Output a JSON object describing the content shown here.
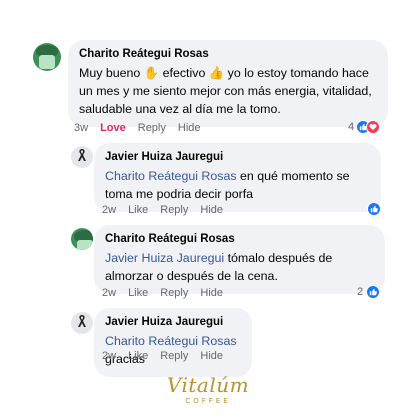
{
  "comments": [
    {
      "author": "Charito Reátegui Rosas",
      "text_parts": [
        "Muy bueno ",
        " efectivo ",
        " yo lo estoy tomando hace un mes y me siento mejor con más energia, vitalidad, saludable una vez al día me la tomo."
      ],
      "time": "3w",
      "love_label": "Love",
      "reply_label": "Reply",
      "hide_label": "Hide",
      "reaction_count": "4",
      "reactions": [
        "like-icon",
        "love-icon"
      ]
    },
    {
      "author": "Javier Huiza Jauregui",
      "mention": "Charito Reátegui Rosas",
      "text": " en qué momento se toma me podria decir porfa",
      "time": "2w",
      "like_label": "Like",
      "reply_label": "Reply",
      "hide_label": "Hide",
      "reactions": [
        "like-icon"
      ]
    },
    {
      "author": "Charito Reátegui Rosas",
      "mention": "Javier Huiza Jauregui",
      "text": " tómalo después de almorzar o después de la cena.",
      "time": "2w",
      "like_label": "Like",
      "reply_label": "Reply",
      "hide_label": "Hide",
      "reaction_count": "2",
      "reactions": [
        "like-icon"
      ]
    },
    {
      "author": "Javier Huiza Jauregui",
      "mention": "Charito Reátegui Rosas",
      "text": " gracias",
      "time": "2w",
      "like_label": "Like",
      "reply_label": "Reply",
      "hide_label": "Hide"
    }
  ],
  "brand": {
    "name": "Vitalúm",
    "sub": "COFFEE",
    "color": "#b8922e"
  },
  "colors": {
    "bubble": "#f0f2f5",
    "mention": "#385898",
    "love": "#e0245e",
    "like": "#1877f2"
  }
}
